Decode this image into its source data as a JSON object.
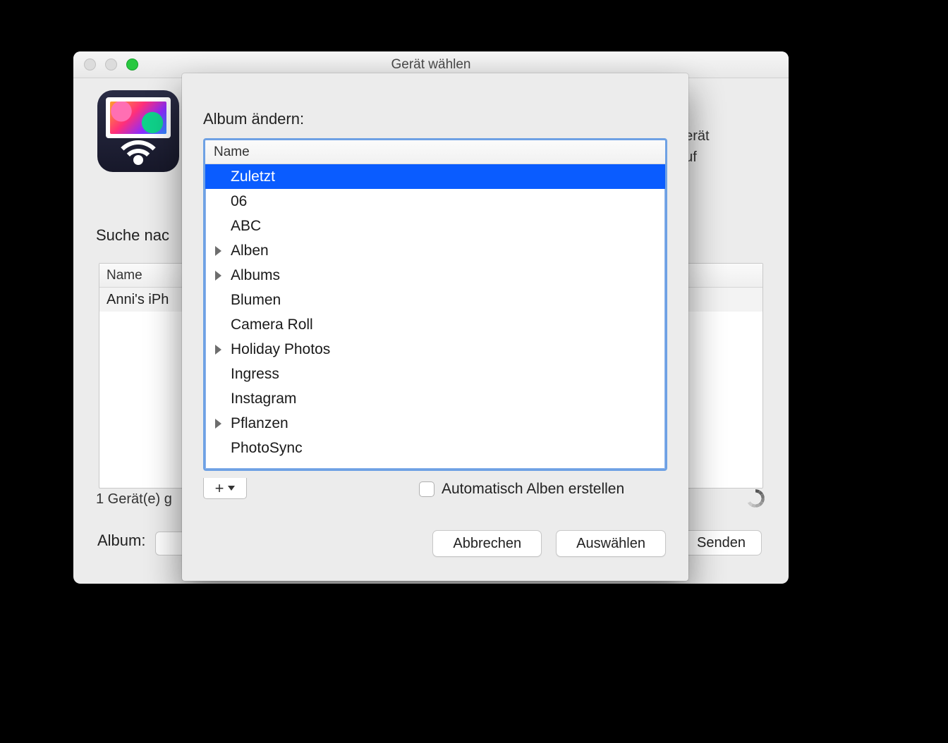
{
  "window": {
    "title": "Gerät wählen",
    "search_label": "Suche nac",
    "device_table": {
      "header": "Name",
      "rows": [
        "Anni's iPh"
      ]
    },
    "found_label": "1 Gerät(e) g",
    "album_label": "Album:",
    "send_label": "Senden",
    "right_text_line1": "gerät",
    "right_text_line2": "auf"
  },
  "sheet": {
    "title": "Album ändern:",
    "header": "Name",
    "items": [
      {
        "label": "Zuletzt",
        "selected": true,
        "expandable": false
      },
      {
        "label": "06",
        "selected": false,
        "expandable": false
      },
      {
        "label": "ABC",
        "selected": false,
        "expandable": false
      },
      {
        "label": "Alben",
        "selected": false,
        "expandable": true
      },
      {
        "label": "Albums",
        "selected": false,
        "expandable": true
      },
      {
        "label": "Blumen",
        "selected": false,
        "expandable": false
      },
      {
        "label": "Camera Roll",
        "selected": false,
        "expandable": false
      },
      {
        "label": "Holiday Photos",
        "selected": false,
        "expandable": true
      },
      {
        "label": "Ingress",
        "selected": false,
        "expandable": false
      },
      {
        "label": "Instagram",
        "selected": false,
        "expandable": false
      },
      {
        "label": "Pflanzen",
        "selected": false,
        "expandable": true
      },
      {
        "label": "PhotoSync",
        "selected": false,
        "expandable": false
      }
    ],
    "auto_create_label": "Automatisch Alben erstellen",
    "auto_create_checked": false,
    "cancel_label": "Abbrechen",
    "choose_label": "Auswählen"
  }
}
